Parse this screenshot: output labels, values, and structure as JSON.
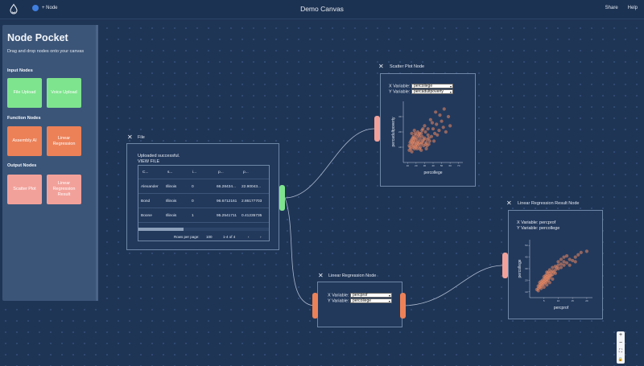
{
  "header": {
    "add_node_label": "+ Node",
    "title": "Demo Canvas",
    "share_label": "Share",
    "help_label": "Help"
  },
  "pocket": {
    "title": "Node Pocket",
    "description": "Drag and drop nodes onto your canvas",
    "sections": {
      "input": {
        "title": "Input Nodes",
        "tiles": [
          "File Upload",
          "Voice Upload"
        ]
      },
      "function": {
        "title": "Function Nodes",
        "tiles": [
          "Assembly AI",
          "Linear Regression"
        ]
      },
      "output": {
        "title": "Output Nodes",
        "tiles": [
          "Scatter Plot",
          "Linear Regression Result"
        ]
      }
    }
  },
  "file_node": {
    "title": "File",
    "message": "Uploaded successful.",
    "view_link": "VIEW FILE",
    "columns": [
      "C...",
      "s...",
      "i...",
      "p...",
      "p..."
    ],
    "rows": [
      [
        "Alexander",
        "Illinois",
        "0",
        "66.28434...",
        "22.90043..."
      ],
      [
        "Bond",
        "Illinois",
        "0",
        "96.6712161",
        "2.86177703"
      ],
      [
        "Boone",
        "Illinois",
        "1",
        "95.2541711",
        "0.41235735"
      ]
    ],
    "pagination": {
      "rows_per_page_label": "Rows per page:",
      "rows_per_page": "100",
      "range": "1-4 of 4"
    }
  },
  "scatter_node": {
    "title": "Scatter Plot Node",
    "x_label": "X Variable:",
    "x_value": "percollege",
    "y_label": "Y Variable:",
    "y_value": "percadultpoverty"
  },
  "regression_node": {
    "title": "Linear Regression Node",
    "x_label": "X Variable:",
    "x_value": "percprof",
    "y_label": "Y Variable:",
    "y_value": "percollege"
  },
  "result_node": {
    "title": "Linear Regression Result Node",
    "x_line": "X Variable: percprof",
    "y_line": "Y Variable: percollege"
  },
  "zoom": {
    "in": "+",
    "out": "−",
    "fit": "⛶",
    "lock": "🔒"
  },
  "colors": {
    "canvas": "#1f3556",
    "green": "#7ee48e",
    "orange": "#ec8158",
    "pink": "#f2a19a",
    "point": "#ef8a62"
  },
  "chart_data": [
    {
      "type": "scatter",
      "xlabel": "percollege",
      "ylabel": "percadultpoverty",
      "xticks": [
        "10",
        "20",
        "30",
        "40",
        "50",
        "60",
        "70"
      ],
      "yticks": [
        "10",
        "20",
        "30"
      ],
      "xlim": [
        5,
        75
      ],
      "ylim": [
        0,
        40
      ],
      "points": [
        [
          12,
          8
        ],
        [
          13,
          10
        ],
        [
          14,
          9
        ],
        [
          15,
          12
        ],
        [
          15,
          7
        ],
        [
          16,
          11
        ],
        [
          17,
          14
        ],
        [
          18,
          9
        ],
        [
          18,
          13
        ],
        [
          19,
          15
        ],
        [
          20,
          10
        ],
        [
          20,
          12
        ],
        [
          21,
          16
        ],
        [
          22,
          11
        ],
        [
          22,
          14
        ],
        [
          23,
          18
        ],
        [
          24,
          13
        ],
        [
          24,
          9
        ],
        [
          25,
          15
        ],
        [
          26,
          12
        ],
        [
          27,
          17
        ],
        [
          28,
          14
        ],
        [
          29,
          11
        ],
        [
          30,
          16
        ],
        [
          31,
          20
        ],
        [
          32,
          13
        ],
        [
          33,
          15
        ],
        [
          34,
          18
        ],
        [
          35,
          12
        ],
        [
          36,
          14
        ],
        [
          14,
          14
        ],
        [
          16,
          16
        ],
        [
          17,
          10
        ],
        [
          19,
          11
        ],
        [
          21,
          9
        ],
        [
          23,
          12
        ],
        [
          25,
          10
        ],
        [
          27,
          13
        ],
        [
          29,
          15
        ],
        [
          31,
          12
        ],
        [
          33,
          11
        ],
        [
          35,
          16
        ],
        [
          20,
          18
        ],
        [
          22,
          20
        ],
        [
          24,
          17
        ],
        [
          26,
          19
        ],
        [
          28,
          22
        ],
        [
          30,
          24
        ],
        [
          13,
          13
        ],
        [
          15,
          15
        ],
        [
          17,
          17
        ],
        [
          19,
          19
        ],
        [
          38,
          17
        ],
        [
          40,
          22
        ],
        [
          42,
          19
        ],
        [
          44,
          25
        ],
        [
          45,
          18
        ],
        [
          47,
          21
        ],
        [
          50,
          27
        ],
        [
          52,
          23
        ],
        [
          55,
          20
        ],
        [
          58,
          30
        ],
        [
          60,
          24
        ],
        [
          37,
          28
        ],
        [
          48,
          31
        ],
        [
          15,
          19
        ],
        [
          18,
          21
        ],
        [
          26,
          8
        ],
        [
          32,
          9
        ],
        [
          41,
          14
        ],
        [
          12,
          11
        ],
        [
          16,
          13
        ],
        [
          18,
          16
        ],
        [
          21,
          13
        ],
        [
          24,
          19
        ],
        [
          27,
          21
        ],
        [
          34,
          22
        ],
        [
          39,
          26
        ],
        [
          53,
          35
        ],
        [
          43,
          33
        ]
      ]
    },
    {
      "type": "scatter",
      "xlabel": "percprof",
      "ylabel": "percollege",
      "xticks": [
        "5",
        "10",
        "15",
        "20"
      ],
      "yticks": [
        "10",
        "20",
        "30",
        "40",
        "50"
      ],
      "xlim": [
        0,
        22
      ],
      "ylim": [
        5,
        55
      ],
      "points": [
        [
          2.5,
          12
        ],
        [
          3,
          13
        ],
        [
          3,
          15
        ],
        [
          3.5,
          14
        ],
        [
          3.5,
          16
        ],
        [
          4,
          15
        ],
        [
          4,
          17
        ],
        [
          4,
          19
        ],
        [
          4.5,
          16
        ],
        [
          4.5,
          18
        ],
        [
          4.5,
          20
        ],
        [
          5,
          17
        ],
        [
          5,
          19
        ],
        [
          5,
          21
        ],
        [
          5,
          23
        ],
        [
          5.5,
          18
        ],
        [
          5.5,
          20
        ],
        [
          5.5,
          22
        ],
        [
          5.5,
          24
        ],
        [
          6,
          19
        ],
        [
          6,
          21
        ],
        [
          6,
          23
        ],
        [
          6,
          25
        ],
        [
          6.5,
          20
        ],
        [
          6.5,
          22
        ],
        [
          6.5,
          24
        ],
        [
          6.5,
          27
        ],
        [
          7,
          22
        ],
        [
          7,
          24
        ],
        [
          7,
          26
        ],
        [
          7,
          29
        ],
        [
          7.5,
          24
        ],
        [
          7.5,
          27
        ],
        [
          8,
          25
        ],
        [
          8,
          28
        ],
        [
          8,
          31
        ],
        [
          8.5,
          27
        ],
        [
          9,
          29
        ],
        [
          9,
          32
        ],
        [
          9.5,
          31
        ],
        [
          10,
          33
        ],
        [
          10,
          30
        ],
        [
          11,
          34
        ],
        [
          11,
          31
        ],
        [
          12,
          36
        ],
        [
          12,
          33
        ],
        [
          13,
          35
        ],
        [
          14,
          38
        ],
        [
          15,
          37
        ],
        [
          16,
          40
        ],
        [
          17,
          42
        ],
        [
          18,
          44
        ],
        [
          20,
          45
        ],
        [
          3,
          11
        ],
        [
          4,
          13
        ],
        [
          5,
          14
        ],
        [
          6,
          16
        ],
        [
          7,
          18
        ],
        [
          8,
          21
        ],
        [
          3.5,
          18
        ],
        [
          6,
          27
        ],
        [
          9,
          26
        ],
        [
          14,
          33
        ],
        [
          12,
          40
        ],
        [
          10,
          36
        ],
        [
          11,
          38
        ],
        [
          13,
          41
        ],
        [
          16,
          36
        ]
      ]
    }
  ]
}
